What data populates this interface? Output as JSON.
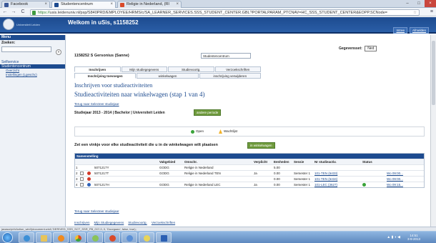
{
  "browser": {
    "tabs": [
      {
        "label": "Facebook",
        "fav": "#3b5998"
      },
      {
        "label": "Studentencentrum",
        "fav": "#1d4b8f"
      },
      {
        "label": "Religie in Nederland, (RI",
        "fav": "#d94a2a"
      }
    ],
    "url_https": "https://",
    "url_rest": "usis.leidenuniv.nl/psp/S840PRD/EMPLOYEE/HRMS/c/SA_LEARNER_SERVICES.SSS_STUDENT_CENTER.GBL?PORTALPARAM_PTCNAV=HC_SSS_STUDENT_CENTER&EOPP.SCNode=",
    "back_icon": "back-arrow-icon",
    "forward_icon": "forward-arrow-icon",
    "reload_icon": "reload-icon"
  },
  "header": {
    "logo_text": "Universiteit Leiden",
    "welcome": "Welkom in uSis, s1158252",
    "links": [
      "Intree",
      "Afmelden"
    ]
  },
  "sidebar": {
    "menu_label": "Menu",
    "zoeken_label": "Zoeken:",
    "items": [
      {
        "label": "Selfservice",
        "type": "group"
      },
      {
        "label": "Studentencentrum",
        "type": "selected"
      },
      {
        "label": "Overzicht",
        "type": "sub"
      },
      {
        "label": "Instellingen (Lgeschc)",
        "type": "sub"
      }
    ]
  },
  "main": {
    "student": "1158252 S Gersonius (Sanne)",
    "center_select": "Studentencentrum",
    "gegevensset_label": "Gegevensset:",
    "gegevensset_value": "Ned",
    "tabs_row1": [
      "Inschrijven",
      "Mijn studiegegevens",
      "Studievoortg.",
      "Verzoekschriften"
    ],
    "tabs_row2": [
      "Inschrijving toevoegen",
      "winkelwagen",
      "inschrijving verwijderen"
    ],
    "section_title": "Inschrijven voor studieactiviteiten",
    "subtitle": "Studieactiviteiten naar winkelwagen (stap 1 van 4)",
    "back_link": "Terug naar Selecteer studiejaar",
    "year_text": "Studiejaar 2013 - 2014 | Bachelor | Universiteit Leiden",
    "year_button": "andere periode",
    "legend_open": "Open",
    "legend_wait": "Wachtlijst",
    "instruction": "Zet een vinkje voor elke studieactiviteit die u in de winkelwagen wilt plaatsen",
    "cart_button": "in winkelwagen",
    "table": {
      "caption": "Samenstelling",
      "headers": [
        "",
        "",
        "",
        "",
        "Vakgebied",
        "Omschr.",
        "Verplicht",
        "Eenheden",
        "Sessie",
        "Nr studieactiv.",
        "Status",
        ""
      ],
      "rows": [
        {
          "num": "1",
          "check": false,
          "icon": "",
          "code": "5071217Y",
          "vak": "GODG",
          "omschr": "Religie in Nederland",
          "verpl": "",
          "eenh": "5.00",
          "sessie": "",
          "nr": "",
          "status": false,
          "link": ""
        },
        {
          "num": "2",
          "check": true,
          "icon": "warn",
          "code": "5071217T",
          "vak": "GODG",
          "omschr": "Religie in Nederland TEN",
          "verpl": "Ja",
          "eenh": "0.00",
          "sessie": "Semester 1",
          "nr": "101-TEN (6433)",
          "status": false,
          "link": "Wo 09:00..."
        },
        {
          "num": "3",
          "check": true,
          "icon": "warn",
          "code": "",
          "vak": "",
          "omschr": "",
          "verpl": "",
          "eenh": "0.00",
          "sessie": "Semester 1",
          "nr": "101-TEN (6434)",
          "status": false,
          "link": "Wo 09:00..."
        },
        {
          "num": "4",
          "check": true,
          "icon": "info",
          "code": "5071217H",
          "vak": "GODG",
          "omschr": "Religie in Nederland LEC",
          "verpl": "Ja",
          "eenh": "0.00",
          "sessie": "Semester 1",
          "nr": "101-LEC (3627)",
          "status": true,
          "link": "Wo 09:15..."
        }
      ]
    },
    "back_link2": "Terug naar Selecteer studiejaar",
    "footer_links": [
      "Inschrijven",
      "Mijn Studiegegevens",
      "Studievoortg.",
      "Verzoekschriften"
    ]
  },
  "statusbar": "javascript:hAction_win0(document.win0,'DERIVED_SSS_SCT_SSR_PB_GO',0, 0, 'Doorgaan', false, true);",
  "taskbar": {
    "time": "14:51",
    "date": "3-9-2013"
  }
}
